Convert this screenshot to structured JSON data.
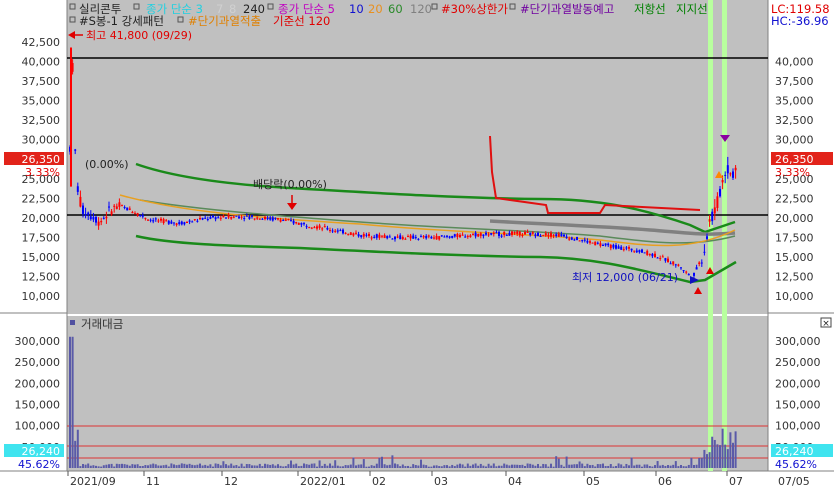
{
  "legend_top": {
    "name": "실리콘투",
    "close_simple_1": "종가 단순 3",
    "ma_7": "7",
    "ma_8": "8",
    "ma_240": "240",
    "close_simple_2": "종가 단순 5",
    "ma_10": "10",
    "ma_20": "20",
    "ma_60": "60",
    "ma_120": "120",
    "upper_limit": "#30%상한가",
    "short_over": "#단기과열발동예고",
    "resistance": "저항선",
    "support": "지지선"
  },
  "legend_second": {
    "pattern": "#S봉-1 강세패턴",
    "short_accum": "#단기과열적출",
    "base_line": "기준선 120"
  },
  "right_info": {
    "lc": "LC:119.58",
    "hc": "HC:-36.96"
  },
  "annotations": {
    "high": "최고 41,800 (09/29)",
    "low": "최저 12,000 (06/21)",
    "dividend": "배당락(0.00%)",
    "zero_pct": "(0.00%)"
  },
  "price_box": {
    "value": "26,350",
    "pct": "3.33%"
  },
  "volume": {
    "title": "거래대금",
    "box_value": "26,240",
    "pct": "45.62%"
  },
  "colors": {
    "bg_chart": "#c0c0c0",
    "up": "#ff0000",
    "down": "#0000ff",
    "highlight": "#b8ff9e",
    "box": "#e2231a",
    "vol_box": "#3fe4ef"
  },
  "price_axis": {
    "ticks": [
      "42,500",
      "40,000",
      "37,500",
      "35,000",
      "32,500",
      "30,000",
      "27,500",
      "25,000",
      "22,500",
      "20,000",
      "17,500",
      "15,000",
      "12,500",
      "10,000"
    ],
    "right_ticks": [
      "40,000",
      "37,500",
      "35,000",
      "32,500",
      "30,000",
      "27,500",
      "25,000",
      "22,500",
      "20,000",
      "17,500",
      "15,000",
      "12,500",
      "10,000"
    ]
  },
  "volume_axis": {
    "ticks": [
      "300,000",
      "250,000",
      "200,000",
      "150,000",
      "100,000",
      "50,000"
    ]
  },
  "date_axis": {
    "labels": [
      "2021/09",
      "11",
      "12",
      "2022/01",
      "02",
      "03",
      "04",
      "05",
      "06",
      "07",
      "07/05"
    ]
  }
}
